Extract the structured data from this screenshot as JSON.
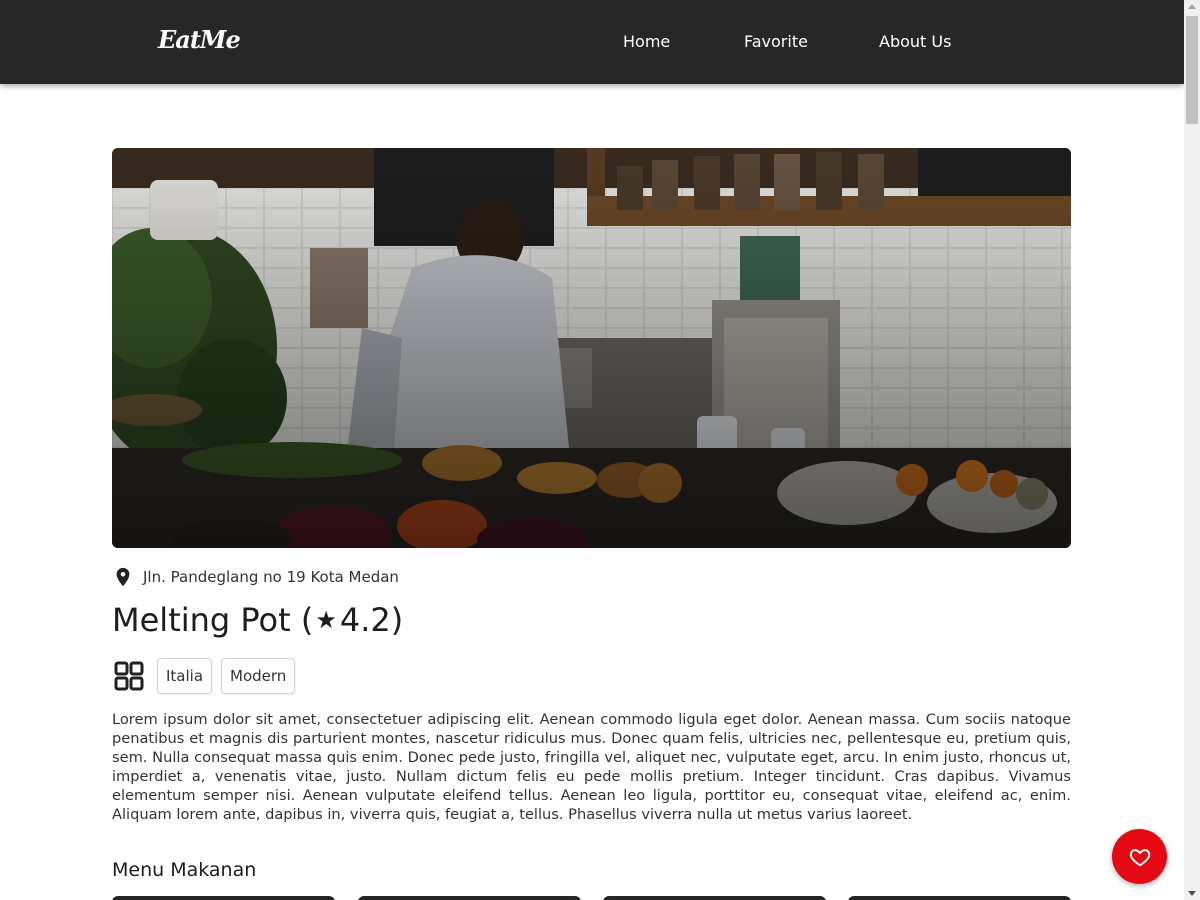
{
  "header": {
    "brand": "EatMe",
    "nav": [
      "Home",
      "Favorite",
      "About Us"
    ]
  },
  "restaurant": {
    "address": "Jln. Pandeglang no 19 Kota Medan",
    "name": "Melting Pot",
    "rating": "4.2",
    "title_open": "Melting Pot (",
    "title_close": " 4.2)",
    "categories": [
      "Italia",
      "Modern"
    ],
    "description": "Lorem ipsum dolor sit amet, consectetuer adipiscing elit. Aenean commodo ligula eget dolor. Aenean massa. Cum sociis natoque penatibus et magnis dis parturient montes, nascetur ridiculus mus. Donec quam felis, ultricies nec, pellentesque eu, pretium quis, sem. Nulla consequat massa quis enim. Donec pede justo, fringilla vel, aliquet nec, vulputate eget, arcu. In enim justo, rhoncus ut, imperdiet a, venenatis vitae, justo. Nullam dictum felis eu pede mollis pretium. Integer tincidunt. Cras dapibus. Vivamus elementum semper nisi. Aenean vulputate eleifend tellus. Aenean leo ligula, porttitor eu, consequat vitae, eleifend ac, enim. Aliquam lorem ante, dapibus in, viverra quis, feugiat a, tellus. Phasellus viverra nulla ut metus varius laoreet."
  },
  "menu": {
    "heading": "Menu Makanan"
  },
  "icons": {
    "location": "location-pin-icon",
    "category": "category-grid-icon",
    "star": "star-icon",
    "favorite": "heart-icon"
  },
  "colors": {
    "navbar": "#272727",
    "favorite_button": "#e50914"
  }
}
